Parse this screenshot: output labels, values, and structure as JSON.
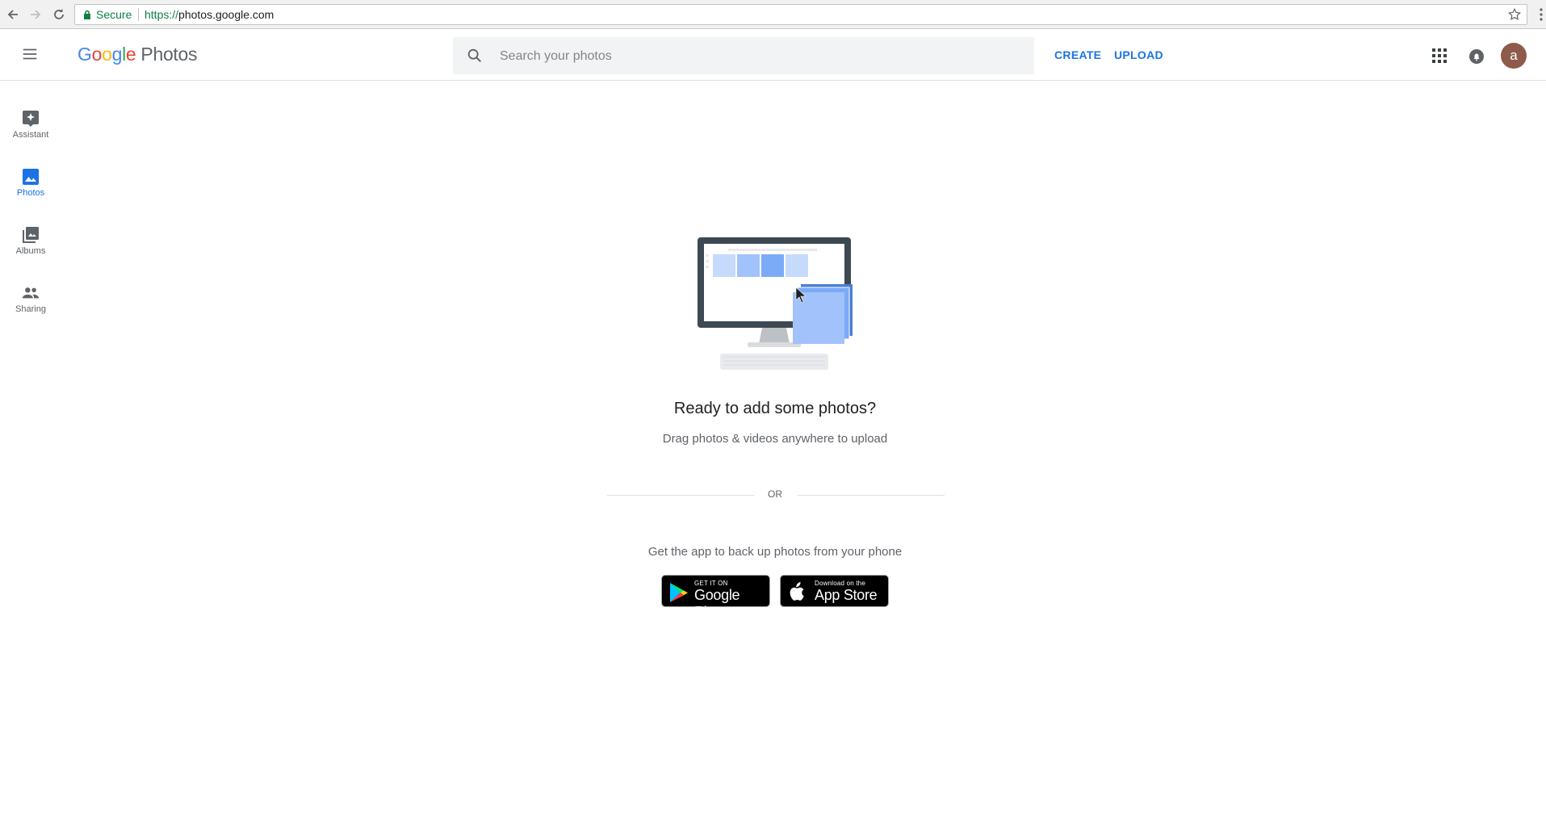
{
  "browser": {
    "secure_label": "Secure",
    "url_scheme": "https://",
    "url_host": "photos.google.com",
    "icons": [
      "back-arrow-icon",
      "forward-arrow-icon",
      "reload-icon",
      "lock-icon",
      "star-icon",
      "kebab-menu-icon"
    ]
  },
  "header": {
    "logo_letters": [
      "G",
      "o",
      "o",
      "g",
      "l",
      "e"
    ],
    "logo_colors": [
      "#4285F4",
      "#EA4335",
      "#FBBC05",
      "#4285F4",
      "#34A853",
      "#EA4335"
    ],
    "product_name": "Photos",
    "search_placeholder": "Search your photos",
    "create_label": "CREATE",
    "upload_label": "UPLOAD",
    "avatar_initial": "a",
    "accent_color": "#1a73e8"
  },
  "sidebar": {
    "items": [
      {
        "label": "Assistant",
        "icon": "assistant-icon",
        "active": false
      },
      {
        "label": "Photos",
        "icon": "photos-icon",
        "active": true
      },
      {
        "label": "Albums",
        "icon": "albums-icon",
        "active": false
      },
      {
        "label": "Sharing",
        "icon": "sharing-icon",
        "active": false
      }
    ]
  },
  "empty_state": {
    "title": "Ready to add some photos?",
    "subtitle": "Drag photos & videos anywhere to upload",
    "divider_text": "OR",
    "app_prompt": "Get the app to back up photos from your phone",
    "google_play": {
      "small": "GET IT ON",
      "big": "Google Play"
    },
    "app_store": {
      "small": "Download on the",
      "big": "App Store"
    }
  }
}
